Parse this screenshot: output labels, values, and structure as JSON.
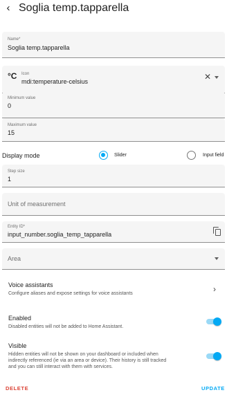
{
  "header": {
    "back_icon": "arrow-left-icon",
    "title": "Soglia temp.tapparella"
  },
  "name_field": {
    "label": "Name*",
    "value": "Soglia temp.tapparella"
  },
  "icon_field": {
    "prefix_glyph": "°C",
    "prefix_icon": "temperature-celsius-icon",
    "label": "Icon",
    "value": "mdi:temperature-celsius",
    "clear_glyph": "✕"
  },
  "min_field": {
    "label": "Minimum value",
    "value": "0"
  },
  "max_field": {
    "label": "Maximum value",
    "value": "15"
  },
  "display_mode": {
    "label": "Display mode",
    "options": [
      {
        "label": "Slider",
        "checked": true
      },
      {
        "label": "Input field",
        "checked": false
      }
    ]
  },
  "step_field": {
    "label": "Step size",
    "value": "1"
  },
  "unit_field": {
    "placeholder": "Unit of measurement"
  },
  "entity_field": {
    "label": "Entity ID*",
    "value": "input_number.soglia_temp_tapparella"
  },
  "area_field": {
    "placeholder": "Area"
  },
  "voice": {
    "title": "Voice assistants",
    "description": "Configure aliases and expose settings for voice assistants",
    "chevron": "›"
  },
  "enabled": {
    "title": "Enabled",
    "description": "Disabled entities will not be added to Home Assistant.",
    "on": true
  },
  "visible": {
    "title": "Visible",
    "description_lines": [
      "Hidden entities will not be shown on your dashboard or included when",
      "indirectly referenced (ie via an area or device). Their history is still tracked",
      "and you can still interact with them with services."
    ],
    "on": true
  },
  "actions": {
    "delete_label": "DELETE",
    "update_label": "UPDATE"
  },
  "colors": {
    "accent": "#03a9f4",
    "danger": "#db4437",
    "field_bg": "#f5f5f5"
  }
}
